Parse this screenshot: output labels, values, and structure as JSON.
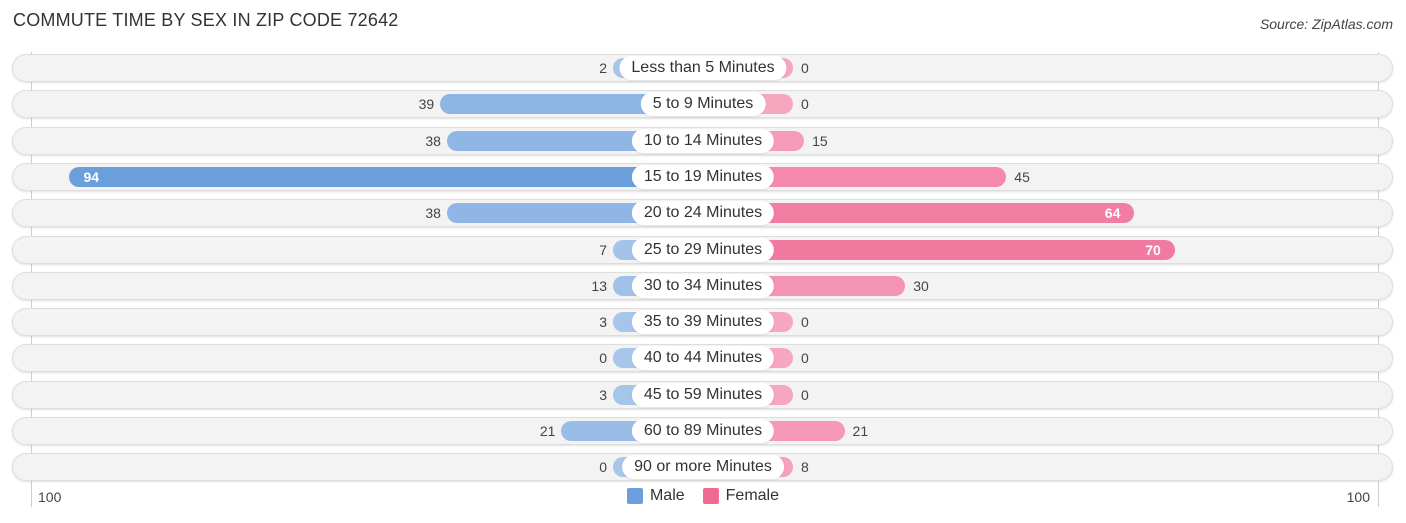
{
  "title": "COMMUTE TIME BY SEX IN ZIP CODE 72642",
  "source": "Source: ZipAtlas.com",
  "colors": {
    "male_strong": "#6a9fdc",
    "male_light": "#a8c6ea",
    "female_strong": "#f06a94",
    "female_light": "#f7a6c0"
  },
  "legend": [
    {
      "label": "Male",
      "color": "#6a9fdc"
    },
    {
      "label": "Female",
      "color": "#f06a94"
    }
  ],
  "axis": {
    "left_label": "100",
    "right_label": "100"
  },
  "chart_data": {
    "type": "bar",
    "orientation": "horizontal-diverging",
    "title": "COMMUTE TIME BY SEX IN ZIP CODE 72642",
    "categories": [
      "Less than 5 Minutes",
      "5 to 9 Minutes",
      "10 to 14 Minutes",
      "15 to 19 Minutes",
      "20 to 24 Minutes",
      "25 to 29 Minutes",
      "30 to 34 Minutes",
      "35 to 39 Minutes",
      "40 to 44 Minutes",
      "45 to 59 Minutes",
      "60 to 89 Minutes",
      "90 or more Minutes"
    ],
    "series": [
      {
        "name": "Male",
        "values": [
          2,
          39,
          38,
          94,
          38,
          7,
          13,
          3,
          0,
          3,
          21,
          0
        ]
      },
      {
        "name": "Female",
        "values": [
          0,
          0,
          15,
          45,
          64,
          70,
          30,
          0,
          0,
          0,
          21,
          8
        ]
      }
    ],
    "xlim": [
      -100,
      100
    ],
    "xtick_labels": [
      "100",
      "100"
    ],
    "legend_position": "bottom-center",
    "grid": false
  }
}
